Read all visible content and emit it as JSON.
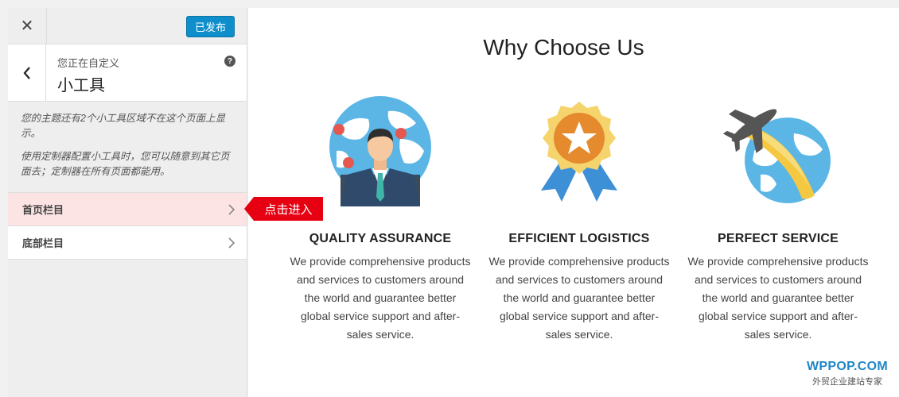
{
  "topbar": {
    "close_label": "✕",
    "publish_label": "已发布"
  },
  "panel": {
    "back_label": "‹",
    "subtitle": "您正在自定义",
    "title": "小工具",
    "help_label": "?"
  },
  "notice": {
    "line1": "您的主题还有2个小工具区域不在这个页面上显示。",
    "line2": "使用定制器配置小工具时，您可以随意到其它页面去；定制器在所有页面都能用。"
  },
  "sections": [
    {
      "label": "首页栏目"
    },
    {
      "label": "底部栏目"
    }
  ],
  "callout": {
    "label": "点击进入"
  },
  "preview": {
    "title": "Why Choose Us",
    "features": [
      {
        "icon": "businessman-globe-icon",
        "title": "QUALITY ASSURANCE",
        "text": "We provide comprehensive products and services to customers around the world and guarantee better global service support and after-sales service."
      },
      {
        "icon": "award-medal-icon",
        "title": "EFFICIENT LOGISTICS",
        "text": "We provide comprehensive products and services to customers around the world and guarantee better global service support and after-sales service."
      },
      {
        "icon": "airplane-globe-icon",
        "title": "PERFECT SERVICE",
        "text": "We provide comprehensive products and services to customers around the world and guarantee better global service support and after-sales service."
      }
    ]
  },
  "brand": {
    "name": "WPPOP.COM",
    "tagline": "外贸企业建站专家",
    "color": "#1f86c8"
  },
  "colors": {
    "publish": "#0e8fcb",
    "callout": "#e60012",
    "active_row": "#fce4e4"
  }
}
